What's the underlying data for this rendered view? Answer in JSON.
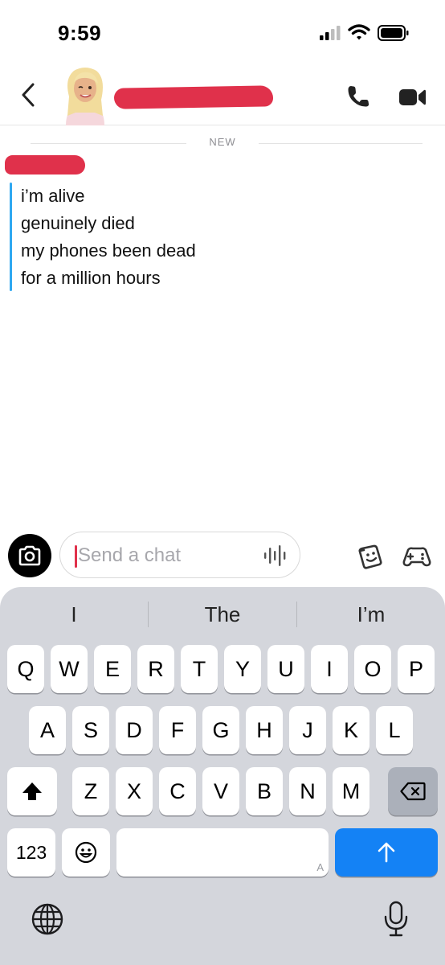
{
  "status_bar": {
    "time": "9:59",
    "icons": [
      "cellular-signal-icon",
      "wifi-icon",
      "battery-icon"
    ]
  },
  "header": {
    "back_icon": "chevron-left-icon",
    "avatar": "bitmoji-avatar",
    "call_icon": "phone-icon",
    "video_icon": "video-camera-icon"
  },
  "divider": {
    "label": "NEW"
  },
  "message": {
    "accent_color": "#2fa8f1",
    "lines": [
      "i’m alive",
      "genuinely died",
      "my phones been dead",
      "for a million hours"
    ]
  },
  "composer": {
    "placeholder": "Send a chat",
    "value": "",
    "camera_icon": "camera-icon",
    "voice_icon": "voice-waveform-icon",
    "sticker_icon": "sticker-icon",
    "game_icon": "game-controller-icon"
  },
  "keyboard": {
    "suggestions": [
      "I",
      "The",
      "I’m"
    ],
    "row1": [
      "Q",
      "W",
      "E",
      "R",
      "T",
      "Y",
      "U",
      "I",
      "O",
      "P"
    ],
    "row2": [
      "A",
      "S",
      "D",
      "F",
      "G",
      "H",
      "J",
      "K",
      "L"
    ],
    "row3": [
      "Z",
      "X",
      "C",
      "V",
      "B",
      "N",
      "M"
    ],
    "numbers_key": "123",
    "space_hint": "A",
    "shift_icon": "shift-arrow-icon",
    "delete_icon": "backspace-icon",
    "emoji_icon": "emoji-icon",
    "send_icon": "arrow-up-icon",
    "globe_icon": "globe-icon",
    "mic_icon": "microphone-icon",
    "send_color": "#1482f5"
  },
  "redaction_color": "#e0314b"
}
